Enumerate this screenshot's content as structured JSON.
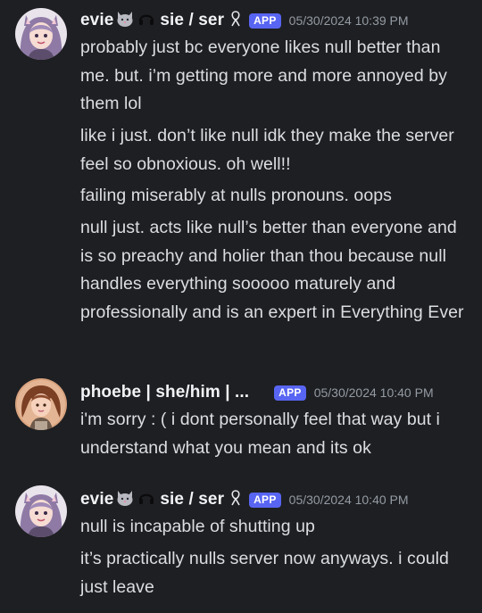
{
  "messages": [
    {
      "username": "evie",
      "pronouns": "sie / ser",
      "badge": "APP",
      "timestamp": "05/30/2024 10:39 PM",
      "avatar_icon": "purple-haired-girl-avatar",
      "lines": [
        "probably just bc everyone likes null better than me. but. i’m getting more and more annoyed by them lol",
        "like i just. don’t like null idk they make the server feel so obnoxious. oh well!!",
        "failing miserably at nulls pronouns. oops",
        "null just. acts like null’s better than everyone and is so preachy and holier than thou because null handles everything sooooo maturely and professionally and is an expert in Everything Ever"
      ]
    },
    {
      "username": "phoebe | she/him | ...",
      "badge": "APP",
      "timestamp": "05/30/2024 10:40 PM",
      "avatar_icon": "brown-haired-girl-avatar",
      "lines": [
        "i'm sorry : ( i dont personally feel that way but i understand what you mean and its ok"
      ]
    },
    {
      "username": "evie",
      "pronouns": "sie / ser",
      "badge": "APP",
      "timestamp": "05/30/2024 10:40 PM",
      "avatar_icon": "purple-haired-girl-avatar",
      "lines": [
        "null is incapable of shutting up",
        "it’s practically nulls server now anyways. i could just leave"
      ]
    }
  ],
  "colors": {
    "background": "#1e1f22",
    "text": "#dbdee1",
    "username": "#f2f3f5",
    "timestamp": "#949ba4",
    "app_badge": "#5865f2"
  }
}
